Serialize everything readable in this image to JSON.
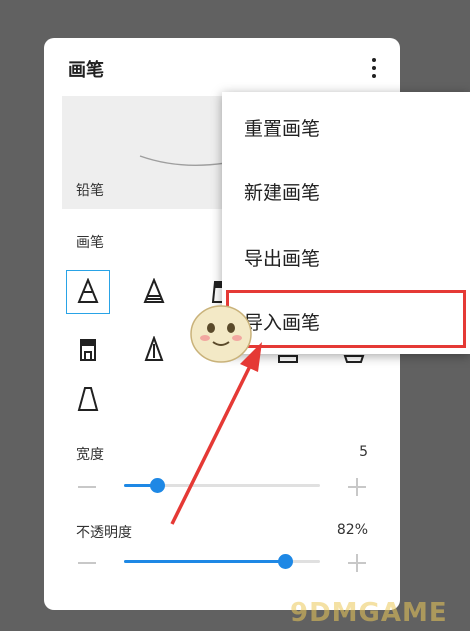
{
  "panel": {
    "title": "画笔",
    "menu_icon": "more-vert-icon",
    "preview": {
      "brush_name": "铅笔"
    },
    "brushes_label": "画笔",
    "brushes": [
      {
        "icon": "pencil-sharp-icon",
        "selected": true
      },
      {
        "icon": "technical-pen-icon",
        "selected": false
      },
      {
        "icon": "marker-icon",
        "selected": false
      },
      {
        "icon": "fat-marker-icon",
        "selected": false
      },
      {
        "icon": "ink-pen-icon",
        "selected": false
      },
      {
        "icon": "fountain-pen-icon",
        "selected": false
      },
      {
        "icon": "felt-tip-icon",
        "selected": false
      },
      {
        "icon": "chisel-marker-icon",
        "selected": false
      },
      {
        "icon": "highlighter-icon",
        "selected": false
      },
      {
        "icon": "soft-pencil-icon",
        "selected": false
      }
    ],
    "width_slider": {
      "label": "宽度",
      "value_text": "5",
      "fraction": 0.17
    },
    "opacity_slider": {
      "label": "不透明度",
      "value_text": "82%",
      "fraction": 0.82
    }
  },
  "menu": {
    "items": [
      {
        "label": "重置画笔"
      },
      {
        "label": "新建画笔"
      },
      {
        "label": "导出画笔"
      },
      {
        "label": "导入画笔",
        "highlighted": true
      }
    ]
  },
  "annotation": {
    "arrow_color": "#e53935",
    "highlight_color": "#e53935"
  },
  "watermark": {
    "text": "9DMGAME"
  },
  "colors": {
    "accent": "#1e88e5",
    "selected_border": "#29a3e6",
    "backdrop": "#616161"
  }
}
